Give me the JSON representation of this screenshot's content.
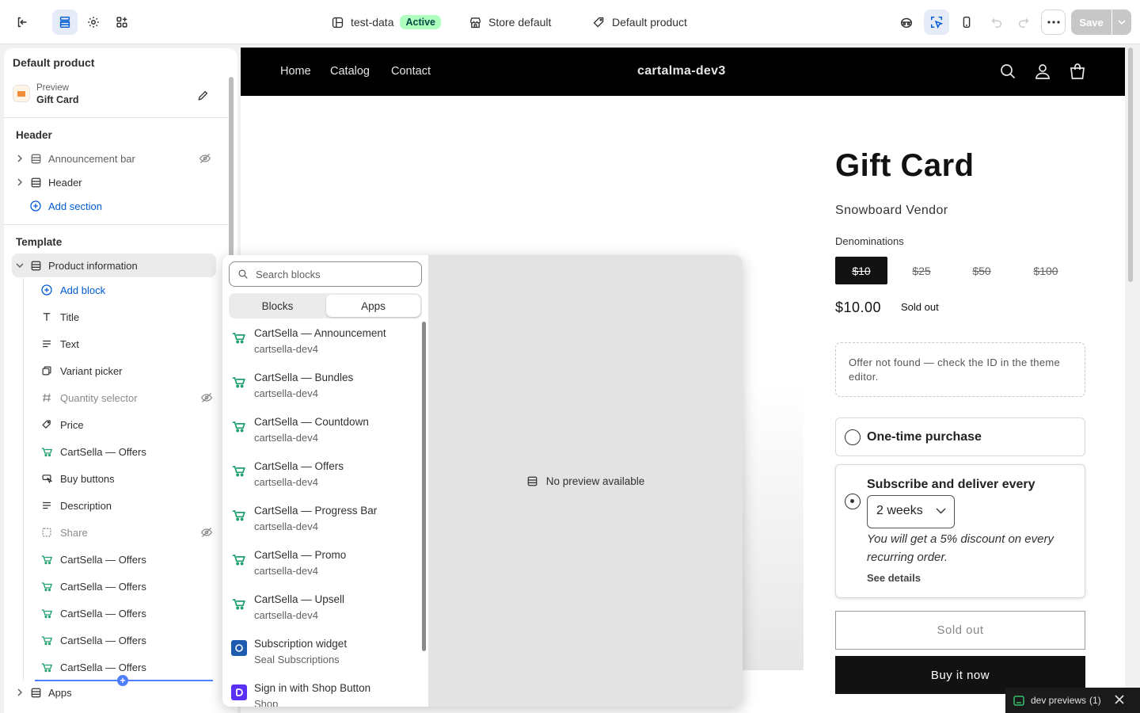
{
  "topbar": {
    "exit_icon": "exit-icon",
    "sections_icon": "sections-icon",
    "settings_icon": "gear-icon",
    "apps_icon": "apps-icon",
    "theme_name": "test-data",
    "theme_status": "Active",
    "store_context": "Store default",
    "template_name": "Default product",
    "save_label": "Save"
  },
  "sidebar": {
    "title": "Default product",
    "preview_label": "Preview",
    "preview_value": "Gift Card",
    "header_group": {
      "heading": "Header",
      "items": [
        {
          "label": "Announcement bar"
        },
        {
          "label": "Header"
        }
      ],
      "add_label": "Add section"
    },
    "template_group": {
      "heading": "Template",
      "section_label": "Product information",
      "add_block_label": "Add block",
      "blocks": [
        {
          "label": "Title",
          "icon": "title-icon"
        },
        {
          "label": "Text",
          "icon": "text-icon"
        },
        {
          "label": "Variant picker",
          "icon": "variant-icon"
        },
        {
          "label": "Quantity selector",
          "icon": "hash-icon"
        },
        {
          "label": "Price",
          "icon": "price-tag-icon"
        },
        {
          "label": "CartSella — Offers",
          "icon": "cartsella-icon"
        },
        {
          "label": "Buy buttons",
          "icon": "buy-buttons-icon"
        },
        {
          "label": "Description",
          "icon": "text-icon"
        },
        {
          "label": "Share",
          "icon": "share-icon"
        },
        {
          "label": "CartSella — Offers",
          "icon": "cartsella-icon"
        },
        {
          "label": "CartSella — Offers",
          "icon": "cartsella-icon"
        },
        {
          "label": "CartSella — Offers",
          "icon": "cartsella-icon"
        },
        {
          "label": "CartSella — Offers",
          "icon": "cartsella-icon"
        },
        {
          "label": "CartSella — Offers",
          "icon": "cartsella-icon"
        }
      ],
      "apps_label": "Apps"
    }
  },
  "store": {
    "nav": [
      "Home",
      "Catalog",
      "Contact"
    ],
    "brand": "cartalma-dev3",
    "product": {
      "title": "Gift Card",
      "vendor": "Snowboard Vendor",
      "denominations_label": "Denominations",
      "denominations": [
        "$10",
        "$25",
        "$50",
        "$100"
      ],
      "selected_denomination": "$10",
      "price": "$10.00",
      "status_badge": "Sold out",
      "offer_message": "Offer not found — check the ID in the theme editor.",
      "one_time_label": "One-time purchase",
      "subscribe_label": "Subscribe and deliver every",
      "frequency": "2 weeks",
      "discount_note": "You will get a 5% discount on every recurring order.",
      "details_link": "See details",
      "sold_out_button": "Sold out",
      "buy_now_button": "Buy it now"
    }
  },
  "picker": {
    "search_placeholder": "Search blocks",
    "tabs": [
      "Blocks",
      "Apps"
    ],
    "active_tab": "Apps",
    "items": [
      {
        "name": "CartSella — Announcement",
        "source": "cartsella-dev4"
      },
      {
        "name": "CartSella — Bundles",
        "source": "cartsella-dev4"
      },
      {
        "name": "CartSella — Countdown",
        "source": "cartsella-dev4"
      },
      {
        "name": "CartSella — Offers",
        "source": "cartsella-dev4"
      },
      {
        "name": "CartSella — Progress Bar",
        "source": "cartsella-dev4"
      },
      {
        "name": "CartSella — Promo",
        "source": "cartsella-dev4"
      },
      {
        "name": "CartSella — Upsell",
        "source": "cartsella-dev4"
      },
      {
        "name": "Subscription widget",
        "source": "Seal Subscriptions"
      },
      {
        "name": "Sign in with Shop Button",
        "source": "Shop"
      }
    ],
    "preview_empty": "No preview available"
  },
  "toast": {
    "label": "dev previews",
    "count": "(1)"
  },
  "colors": {
    "accent_blue": "#005bd3",
    "active_badge_bg": "#affebf",
    "cartsella_green": "#1f9e6e",
    "store_black": "#121212"
  }
}
